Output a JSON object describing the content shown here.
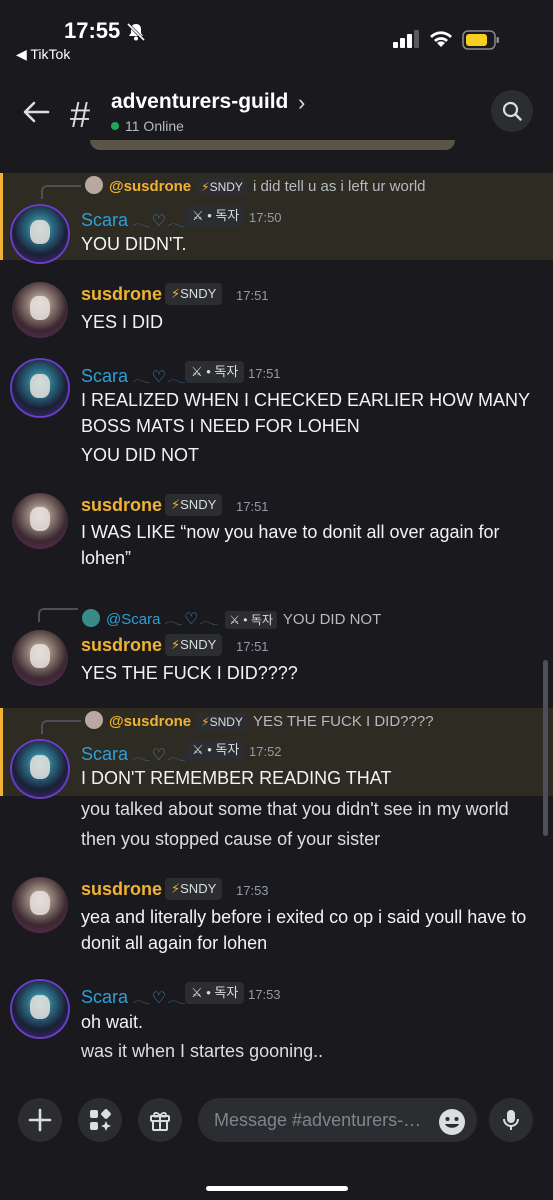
{
  "status": {
    "time": "17:55",
    "back_app": "◀ TikTok"
  },
  "header": {
    "channel": "adventurers-guild",
    "chevron": "›",
    "online": "11 Online"
  },
  "messages": [
    {
      "user": "Scara",
      "deco": "𓂃♡𓂃",
      "tag": "⚔ • 독자",
      "time": "17:50",
      "reply": {
        "mention": "@susdrone",
        "tag_bolt": "⚡",
        "tag": "SNDY",
        "text": "i did tell u as i left ur world"
      },
      "lines": [
        "YOU DIDN'T."
      ]
    },
    {
      "user": "susdrone",
      "tag_bolt": "⚡",
      "tag": "SNDY",
      "time": "17:51",
      "lines": [
        "YES I DID"
      ]
    },
    {
      "user": "Scara",
      "deco": "𓂃♡𓂃",
      "tag": "⚔ • 독자",
      "time": "17:51",
      "lines": [
        "I REALIZED WHEN I CHECKED EARLIER HOW MANY BOSS MATS I NEED FOR LOHEN",
        "YOU DID NOT"
      ]
    },
    {
      "user": "susdrone",
      "tag_bolt": "⚡",
      "tag": "SNDY",
      "time": "17:51",
      "lines": [
        "I WAS LIKE “now you have to donit all over again for lohen”"
      ]
    },
    {
      "user": "susdrone",
      "tag_bolt": "⚡",
      "tag": "SNDY",
      "time": "17:51",
      "reply": {
        "mention": "@Scara",
        "deco": "𓂃♡𓂃",
        "tag": "⚔ • 독자",
        "text": "YOU DID NOT"
      },
      "lines": [
        "YES THE FUCK I DID????"
      ]
    },
    {
      "user": "Scara",
      "deco": "𓂃♡𓂃",
      "tag": "⚔ • 독자",
      "time": "17:52",
      "reply": {
        "mention": "@susdrone",
        "tag_bolt": "⚡",
        "tag": "SNDY",
        "text": "YES THE FUCK I DID????"
      },
      "lines": [
        "I DON'T REMEMBER READING THAT",
        "you talked about some that you didn't see in my world",
        "then you stopped cause of your sister"
      ]
    },
    {
      "user": "susdrone",
      "tag_bolt": "⚡",
      "tag": "SNDY",
      "time": "17:53",
      "lines": [
        "yea and literally before i exited co op i said youll have to donit all again for lohen"
      ]
    },
    {
      "user": "Scara",
      "deco": "𓂃♡𓂃",
      "tag": "⚔ • 독자",
      "time": "17:53",
      "lines": [
        "oh wait.",
        "was it when I startes gooning.."
      ]
    }
  ],
  "composer": {
    "placeholder": "Message #adventurers-…"
  },
  "colors": {
    "background": "#1a1a1e",
    "scara": "#2f9fd8",
    "susdrone": "#f0b232",
    "highlight": "#2e2b22",
    "online": "#23a55a"
  },
  "icons": [
    "mute-icon",
    "signal-icon",
    "wifi-icon",
    "battery-icon",
    "back-arrow-icon",
    "hash-icon",
    "search-icon",
    "plus-icon",
    "apps-icon",
    "gift-icon",
    "emoji-icon",
    "microphone-icon"
  ]
}
